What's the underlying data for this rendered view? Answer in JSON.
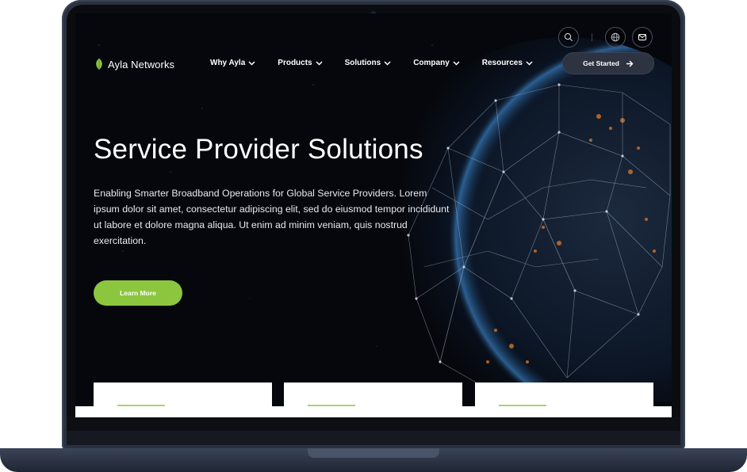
{
  "brand": {
    "name": "Ayla Networks",
    "accent": "#8cc63f"
  },
  "nav": {
    "items": [
      {
        "label": "Why Ayla"
      },
      {
        "label": "Products"
      },
      {
        "label": "Solutions"
      },
      {
        "label": "Company"
      },
      {
        "label": "Resources"
      }
    ],
    "cta_label": "Get Started"
  },
  "utility": {
    "icons": [
      "search-icon",
      "globe-icon",
      "mail-icon"
    ]
  },
  "hero": {
    "title": "Service Provider Solutions",
    "description": "Enabling Smarter Broadband Operations for Global Service Providers. Lorem ipsum dolor sit amet, consectetur adipiscing elit, sed do eiusmod tempor incididunt ut labore et dolore magna aliqua. Ut enim ad minim veniam, quis nostrud exercitation.",
    "button_label": "Learn More"
  }
}
